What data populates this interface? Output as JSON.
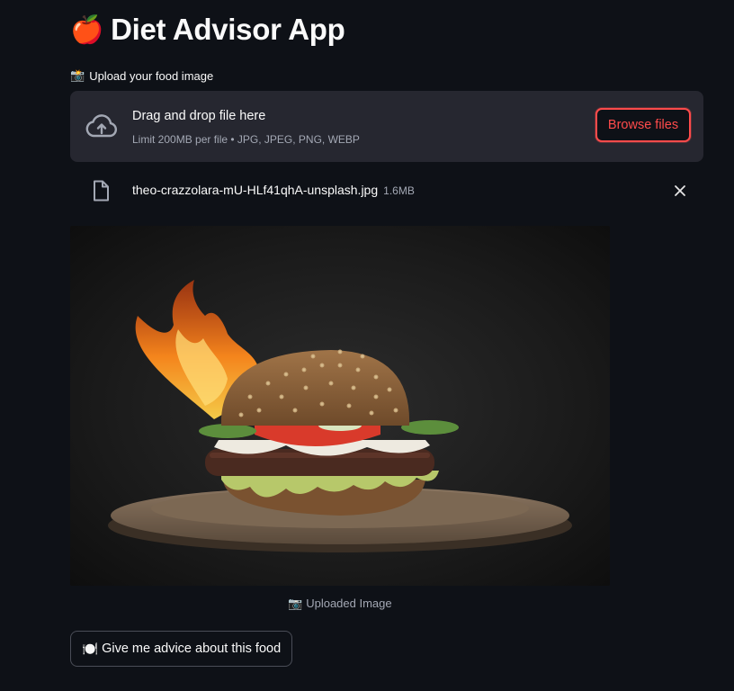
{
  "app": {
    "title_icon": "🍎",
    "title": "Diet Advisor App"
  },
  "uploader": {
    "label_icon": "📸",
    "label": "Upload your food image",
    "drop_text": "Drag and drop file here",
    "limit_text": "Limit 200MB per file • JPG, JPEG, PNG, WEBP",
    "browse_label": "Browse files",
    "upload_icon": "cloud-upload-icon"
  },
  "file": {
    "name": "theo-crazzolara-mU-HLf41qhA-unsplash.jpg",
    "size": "1.6MB",
    "file_icon": "file-icon",
    "remove_icon": "close-icon"
  },
  "image": {
    "caption_icon": "📷",
    "caption": "Uploaded Image",
    "subject": "burger-photo"
  },
  "actions": {
    "advice_icon": "🍽️",
    "advice_label": "Give me advice about this food"
  },
  "colors": {
    "background": "#0e1117",
    "surface": "#262730",
    "accent": "#ff4b4b",
    "muted_text": "#a3a8b4"
  }
}
